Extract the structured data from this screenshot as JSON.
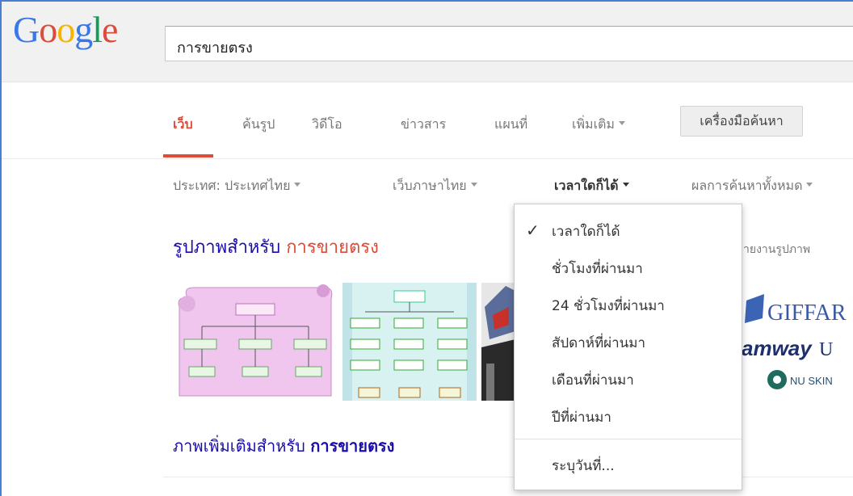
{
  "logo": {
    "letters": [
      "G",
      "o",
      "o",
      "g",
      "l",
      "e"
    ],
    "colors": [
      "#3b78e7",
      "#dd4b39",
      "#f4b400",
      "#3b78e7",
      "#0f9d58",
      "#dd4b39"
    ]
  },
  "search": {
    "query": "การขายตรง"
  },
  "nav": {
    "tabs": [
      {
        "label": "เว็บ",
        "active": true
      },
      {
        "label": "ค้นรูป"
      },
      {
        "label": "วิดีโอ"
      },
      {
        "label": "ข่าวสาร"
      },
      {
        "label": "แผนที่"
      },
      {
        "label": "เพิ่มเติม"
      }
    ],
    "tools_label": "เครื่องมือค้นหา"
  },
  "filters": {
    "country": "ประเทศ: ประเทศไทย",
    "language": "เว็บภาษาไทย",
    "time": "เวลาใดก็ได้",
    "results": "ผลการค้นหาทั้งหมด"
  },
  "images": {
    "title_prefix": "รูปภาพสำหรับ",
    "title_query": "การขายตรง",
    "report": "ายงานรูปภาพ",
    "more_prefix": "ภาพเพิ่มเติมสำหรับ",
    "more_query": "การขายตรง",
    "thumb_text": {
      "giffar": "GIFFAR",
      "amway": "amway",
      "nuskin": "NU SKIN"
    }
  },
  "time_menu": {
    "items": [
      {
        "label": "เวลาใดก็ได้",
        "selected": true
      },
      {
        "label": "ชั่วโมงที่ผ่านมา"
      },
      {
        "label": "24 ชั่วโมงที่ผ่านมา"
      },
      {
        "label": "สัปดาห์ที่ผ่านมา"
      },
      {
        "label": "เดือนที่ผ่านมา"
      },
      {
        "label": "ปีที่ผ่านมา"
      }
    ],
    "custom": "ระบุวันที่...",
    "check_icon": "checkmark-icon"
  }
}
